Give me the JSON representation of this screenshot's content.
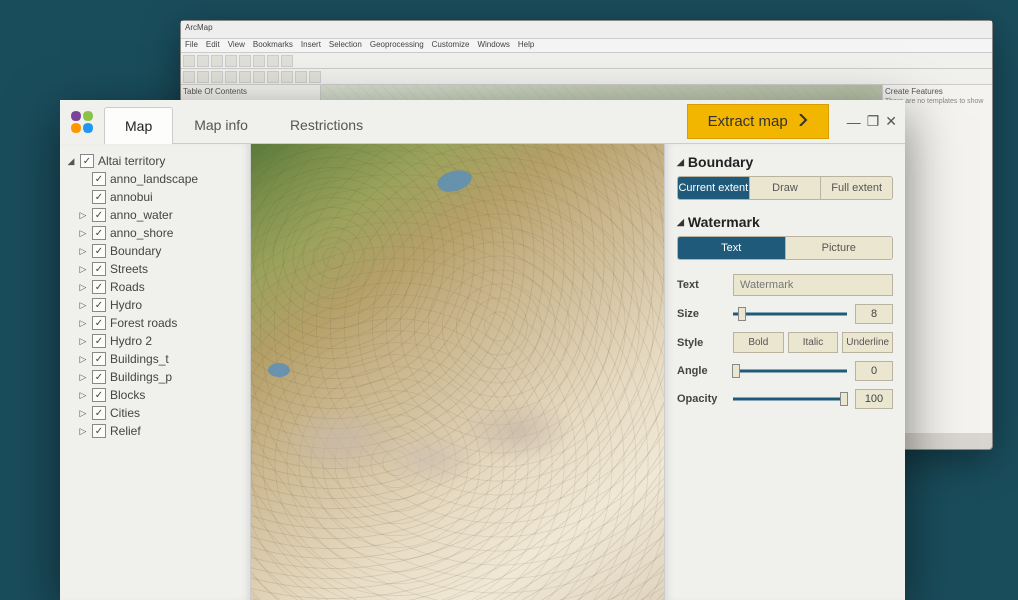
{
  "bg": {
    "title": "ArcMap",
    "menu": [
      "File",
      "Edit",
      "View",
      "Bookmarks",
      "Insert",
      "Selection",
      "Geoprocessing",
      "Customize",
      "Windows",
      "Help"
    ],
    "toc_title": "Table Of Contents",
    "features_title": "Create Features",
    "features_msg": "There are no templates to show"
  },
  "header": {
    "tabs": [
      "Map",
      "Map info",
      "Restrictions"
    ],
    "active_tab": "Map",
    "extract_label": "Extract map"
  },
  "tree": {
    "root": "Altai territory",
    "children_l2": [
      "anno_landscape",
      "annobui"
    ],
    "children_l1": [
      "anno_water",
      "anno_shore",
      "Boundary",
      "Streets",
      "Roads",
      "Hydro",
      "Forest roads",
      "Hydro 2",
      "Buildings_t",
      "Buildings_p",
      "Blocks",
      "Cities",
      "Relief"
    ]
  },
  "boundary": {
    "title": "Boundary",
    "options": [
      "Current extent",
      "Draw",
      "Full extent"
    ],
    "active": "Current extent"
  },
  "watermark": {
    "title": "Watermark",
    "tabs": [
      "Text",
      "Picture"
    ],
    "active_tab": "Text",
    "text_label": "Text",
    "text_value": "Watermark",
    "size_label": "Size",
    "size_value": "8",
    "style_label": "Style",
    "style_options": [
      "Bold",
      "Italic",
      "Underline"
    ],
    "angle_label": "Angle",
    "angle_value": "0",
    "opacity_label": "Opacity",
    "opacity_value": "100"
  }
}
